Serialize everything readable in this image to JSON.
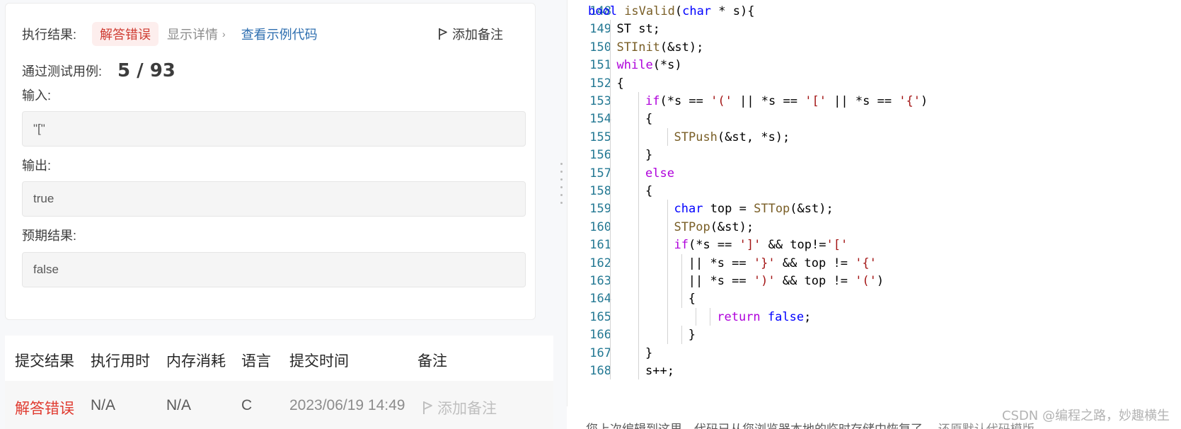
{
  "result": {
    "label": "执行结果:",
    "status": "解答错误",
    "details": "显示详情",
    "example_code": "查看示例代码",
    "add_note": "添加备注",
    "passed_label": "通过测试用例:",
    "passed_value": "5 / 93",
    "input_label": "输入:",
    "input_value": "\"[\"",
    "output_label": "输出:",
    "output_value": "true",
    "expected_label": "预期结果:",
    "expected_value": "false"
  },
  "submissions": {
    "headers": [
      "提交结果",
      "执行用时",
      "内存消耗",
      "语言",
      "提交时间",
      "备注"
    ],
    "rows": [
      {
        "result": "解答错误",
        "runtime": "N/A",
        "memory": "N/A",
        "language": "C",
        "time": "2023/06/19 14:49",
        "note": "添加备注"
      }
    ]
  },
  "editor": {
    "lines": [
      {
        "n": "148",
        "indent": 0,
        "tokens": [
          [
            "kw",
            "bool"
          ],
          [
            "",
            ""
          ],
          [
            "fn",
            " isValid"
          ],
          [
            "",
            "("
          ],
          [
            "kw",
            "char"
          ],
          [
            "",
            " * s){"
          ]
        ]
      },
      {
        "n": "149",
        "indent": 1,
        "tokens": [
          [
            "",
            "ST st;"
          ]
        ]
      },
      {
        "n": "150",
        "indent": 1,
        "tokens": [
          [
            "fn",
            "STInit"
          ],
          [
            "",
            "(&st);"
          ]
        ]
      },
      {
        "n": "151",
        "indent": 1,
        "tokens": [
          [
            "ct",
            "while"
          ],
          [
            "",
            "(*s)"
          ]
        ]
      },
      {
        "n": "152",
        "indent": 1,
        "tokens": [
          [
            "",
            "{"
          ]
        ]
      },
      {
        "n": "153",
        "indent": 2,
        "tokens": [
          [
            "ct",
            "if"
          ],
          [
            "",
            "(*s == "
          ],
          [
            "st",
            "'('"
          ],
          [
            "",
            " || *s == "
          ],
          [
            "st",
            "'['"
          ],
          [
            "",
            " || *s == "
          ],
          [
            "st",
            "'{'"
          ],
          [
            "",
            ")"
          ]
        ]
      },
      {
        "n": "154",
        "indent": 2,
        "tokens": [
          [
            "",
            "{"
          ]
        ]
      },
      {
        "n": "155",
        "indent": 3,
        "tokens": [
          [
            "fn",
            "STPush"
          ],
          [
            "",
            "(&st, *s);"
          ]
        ]
      },
      {
        "n": "156",
        "indent": 2,
        "tokens": [
          [
            "",
            "}"
          ]
        ]
      },
      {
        "n": "157",
        "indent": 2,
        "tokens": [
          [
            "ct",
            "else"
          ]
        ]
      },
      {
        "n": "158",
        "indent": 2,
        "tokens": [
          [
            "",
            "{"
          ]
        ]
      },
      {
        "n": "159",
        "indent": 3,
        "tokens": [
          [
            "kw",
            "char"
          ],
          [
            "",
            " top = "
          ],
          [
            "fn",
            "STTop"
          ],
          [
            "",
            "(&st);"
          ]
        ]
      },
      {
        "n": "160",
        "indent": 3,
        "tokens": [
          [
            "fn",
            "STPop"
          ],
          [
            "",
            "(&st);"
          ]
        ]
      },
      {
        "n": "161",
        "indent": 3,
        "tokens": [
          [
            "ct",
            "if"
          ],
          [
            "",
            "(*s == "
          ],
          [
            "st",
            "']'"
          ],
          [
            "",
            " && top!="
          ],
          [
            "st",
            "'['"
          ]
        ]
      },
      {
        "n": "162",
        "indent": 3.5,
        "tokens": [
          [
            "",
            "|| *s == "
          ],
          [
            "st",
            "'}'"
          ],
          [
            "",
            " && top != "
          ],
          [
            "st",
            "'{'"
          ]
        ]
      },
      {
        "n": "163",
        "indent": 3.5,
        "tokens": [
          [
            "",
            "|| *s == "
          ],
          [
            "st",
            "')'"
          ],
          [
            "",
            " && top != "
          ],
          [
            "st",
            "'('"
          ],
          [
            "",
            ")"
          ]
        ]
      },
      {
        "n": "164",
        "indent": 3.5,
        "tokens": [
          [
            "",
            "{"
          ]
        ]
      },
      {
        "n": "165",
        "indent": 4.5,
        "tokens": [
          [
            "ct",
            "return"
          ],
          [
            "",
            ""
          ],
          [
            "kw",
            " false"
          ],
          [
            "",
            ";"
          ]
        ]
      },
      {
        "n": "166",
        "indent": 3.5,
        "tokens": [
          [
            "",
            "}"
          ]
        ]
      },
      {
        "n": "167",
        "indent": 2,
        "tokens": [
          [
            "",
            "}"
          ]
        ]
      },
      {
        "n": "168",
        "indent": 2,
        "tokens": [
          [
            "",
            "s++;"
          ]
        ]
      }
    ]
  },
  "notice": {
    "text": "您上次编辑到这里，代码已从您浏览器本地的临时存储中恢复了。",
    "link": "还原默认代码模版"
  },
  "watermark": "CSDN @编程之路，妙趣横生",
  "colors": {
    "error": "#e03a2f",
    "link": "#2f6fb0",
    "line_number": "#237893",
    "keyword": "#0000ff",
    "control": "#af00db",
    "function": "#795e26",
    "string": "#a31515"
  }
}
